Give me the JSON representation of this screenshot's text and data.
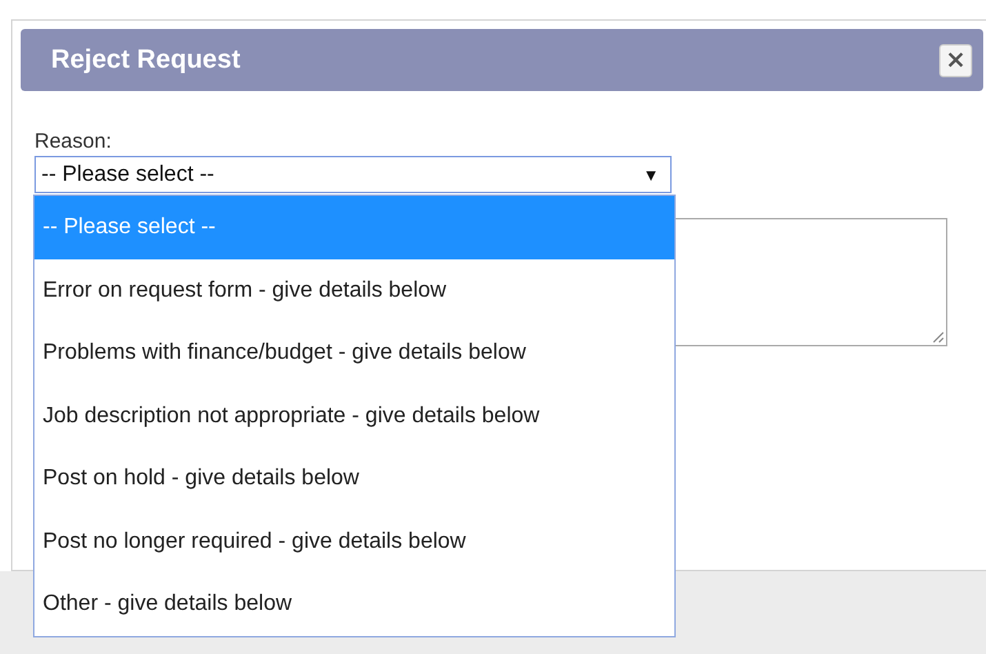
{
  "dialog": {
    "title": "Reject Request",
    "close_label": "×"
  },
  "reason": {
    "label": "Reason:",
    "value": "-- Please select --",
    "caret": "▼",
    "expanded": true,
    "options": [
      {
        "label": "-- Please select --",
        "selected": true
      },
      {
        "label": "Error on request form - give details below",
        "selected": false
      },
      {
        "label": "Problems with finance/budget - give details below",
        "selected": false
      },
      {
        "label": "Job description not appropriate - give details below",
        "selected": false
      },
      {
        "label": "Post on hold - give details below",
        "selected": false
      },
      {
        "label": "Post no longer required - give details below",
        "selected": false
      },
      {
        "label": "Other - give details below",
        "selected": false
      }
    ]
  }
}
